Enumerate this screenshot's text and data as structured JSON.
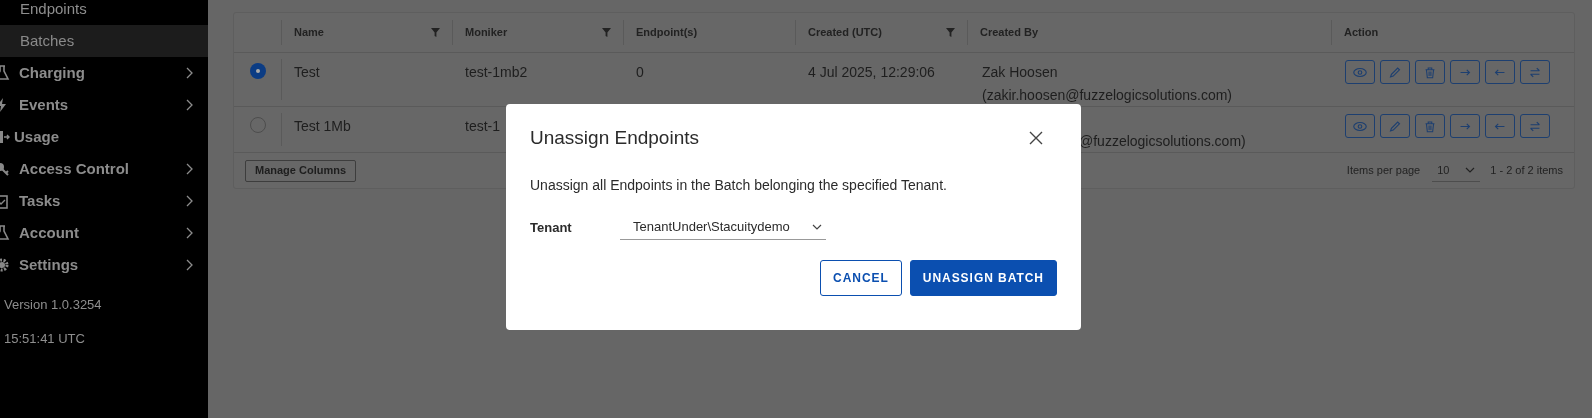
{
  "sidebar": {
    "items": [
      {
        "label": "Endpoints",
        "kind": "sub",
        "selected": false
      },
      {
        "label": "Batches",
        "kind": "sub",
        "selected": true
      },
      {
        "label": "Charging",
        "kind": "group",
        "expandable": true
      },
      {
        "label": "Events",
        "kind": "group",
        "expandable": true
      },
      {
        "label": "Usage",
        "kind": "group",
        "expandable": false
      },
      {
        "label": "Access Control",
        "kind": "group",
        "expandable": true
      },
      {
        "label": "Tasks",
        "kind": "group",
        "expandable": true
      },
      {
        "label": "Account",
        "kind": "group",
        "expandable": true
      },
      {
        "label": "Settings",
        "kind": "group",
        "expandable": true
      }
    ],
    "version": "Version 1.0.3254",
    "time": "15:51:41 UTC"
  },
  "table": {
    "columns": [
      {
        "label": "Name",
        "filter": true
      },
      {
        "label": "Moniker",
        "filter": true
      },
      {
        "label": "Endpoint(s)",
        "filter": false
      },
      {
        "label": "Created (UTC)",
        "filter": true
      },
      {
        "label": "Created By",
        "filter": false
      },
      {
        "label": "Action",
        "filter": false
      }
    ],
    "rows": [
      {
        "selected": true,
        "name": "Test",
        "moniker": "test-1mb2",
        "endpoints": "0",
        "created": "4 Jul 2025, 12:29:06",
        "created_by_name": "Zak Hoosen",
        "created_by_email": "(zakir.hoosen@fuzzelogicsolutions.com)"
      },
      {
        "selected": false,
        "name": "Test 1Mb",
        "moniker": "test-1",
        "created_by_email": "@fuzzelogicsolutions.com)"
      }
    ],
    "manage_columns": "Manage Columns",
    "items_per_page_label": "Items per page",
    "items_per_page": "10",
    "range": "1 - 2 of 2 items"
  },
  "dialog": {
    "title": "Unassign Endpoints",
    "message": "Unassign all Endpoints in the Batch belonging the specified Tenant.",
    "field_label": "Tenant",
    "field_value": "TenantUnder\\Stacuitydemo",
    "buttons": [
      {
        "label": "CANCEL",
        "kind": "secondary"
      },
      {
        "label": "UNASSIGN BATCH",
        "kind": "primary"
      }
    ]
  }
}
